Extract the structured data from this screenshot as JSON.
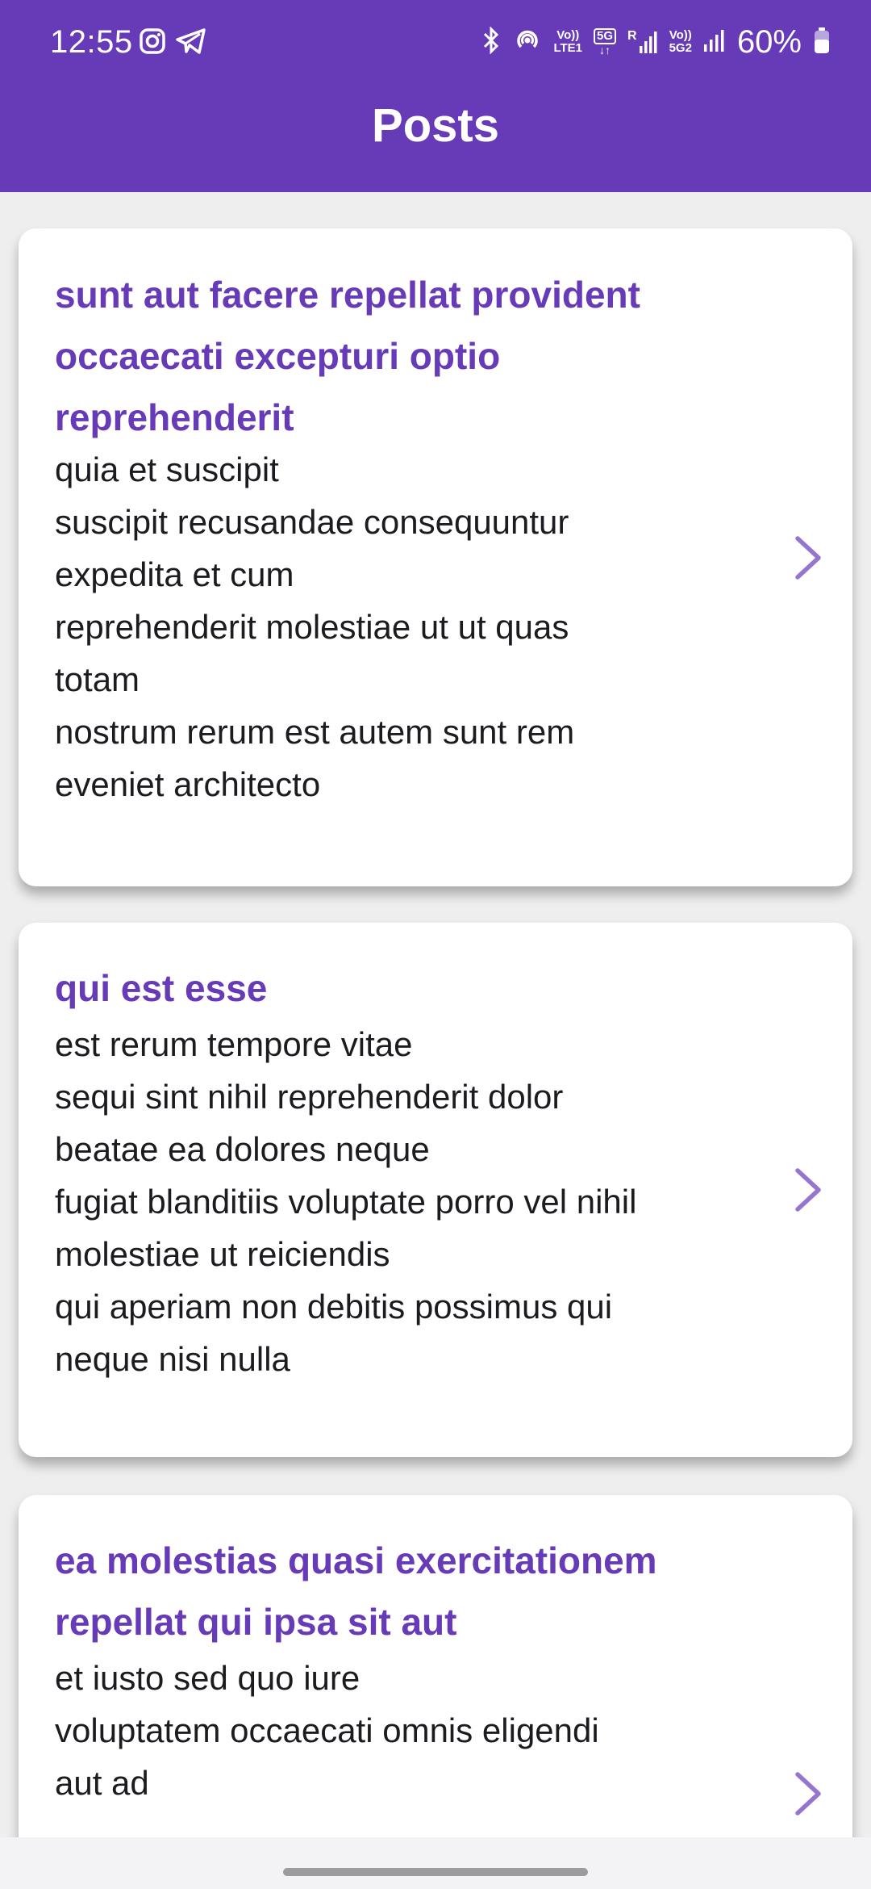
{
  "status_bar": {
    "time": "12:55",
    "left_icons": [
      "instagram-icon",
      "telegram-icon"
    ],
    "right_icons": [
      "bluetooth-icon",
      "hotspot-icon",
      "volte-lte1-icon",
      "5g-icon",
      "signal-r-icon",
      "volte-5g2-icon",
      "signal-icon",
      "battery-icon"
    ],
    "volte1_top": "Vo))",
    "volte1_bottom": "LTE1",
    "fiveg_label": "5G",
    "roaming_label": "R",
    "volte2_top": "Vo))",
    "volte2_bottom": "5G2",
    "battery": "60%"
  },
  "app_bar": {
    "title": "Posts"
  },
  "colors": {
    "primary": "#673ab7",
    "background": "#eeeeee",
    "card": "#ffffff",
    "body_text": "#1d1b20",
    "chevron": "#9575cd"
  },
  "posts": [
    {
      "title": "sunt aut facere repellat provident\noccaecati excepturi optio\nreprehenderit",
      "body": "quia et suscipit\nsuscipit recusandae consequuntur\nexpedita et cum\nreprehenderit molestiae ut ut quas\ntotam\nnostrum rerum est autem sunt rem\neveniet architecto",
      "icon": "chevron-right-icon"
    },
    {
      "title": "qui est esse",
      "body": "est rerum tempore vitae\nsequi sint nihil reprehenderit dolor\nbeatae ea dolores neque\nfugiat blanditiis voluptate porro vel nihil\nmolestiae ut reiciendis\nqui aperiam non debitis possimus qui\nneque nisi nulla",
      "icon": "chevron-right-icon"
    },
    {
      "title": "ea molestias quasi exercitationem\nrepellat qui ipsa sit aut",
      "body": "et iusto sed quo iure\nvoluptatem occaecati omnis eligendi\naut ad",
      "icon": "chevron-right-icon"
    }
  ]
}
